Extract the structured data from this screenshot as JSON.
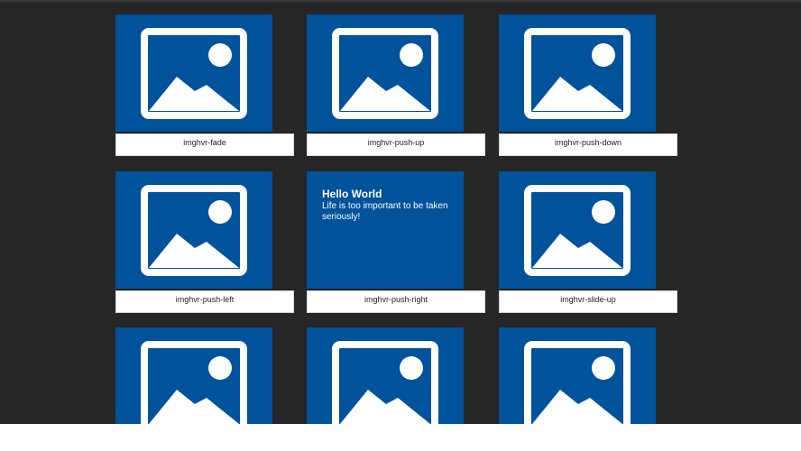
{
  "colors": {
    "background": "#262626",
    "tile": "#00529b",
    "caption_bg": "#ffffff",
    "icon": "#ffffff"
  },
  "icons": {
    "placeholder": "image-icon"
  },
  "cards": [
    {
      "caption": "imghvr-fade"
    },
    {
      "caption": "imghvr-push-up"
    },
    {
      "caption": "imghvr-push-down"
    },
    {
      "caption": "imghvr-push-left"
    },
    {
      "caption": "imghvr-push-right",
      "hover_title": "Hello World",
      "hover_text": "Life is too important to be taken seriously!"
    },
    {
      "caption": "imghvr-slide-up"
    },
    {
      "caption": ""
    },
    {
      "caption": ""
    },
    {
      "caption": ""
    }
  ]
}
